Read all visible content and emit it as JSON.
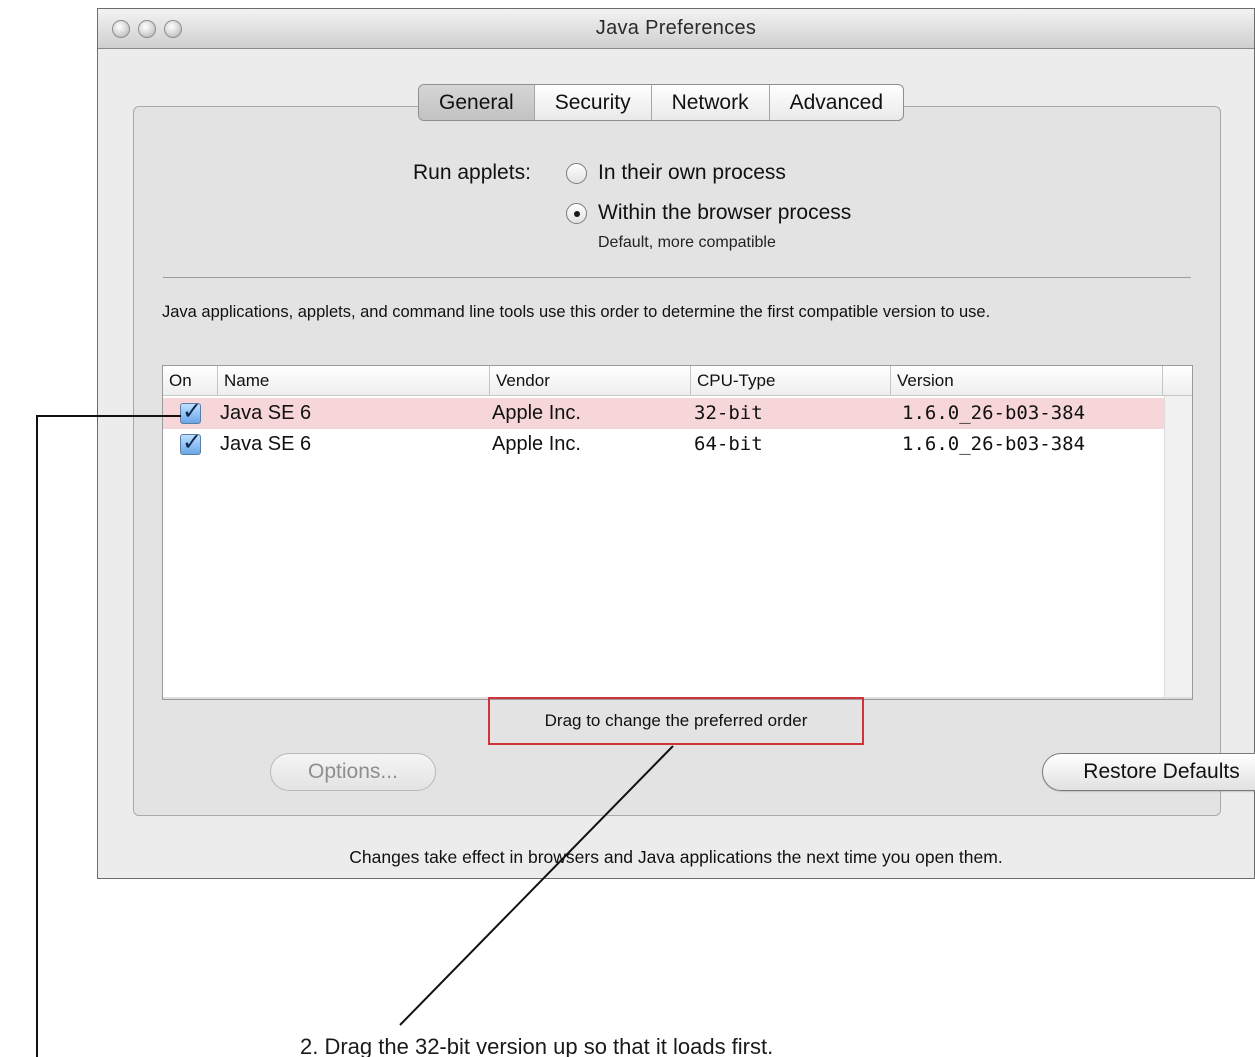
{
  "window": {
    "title": "Java Preferences"
  },
  "tabs": [
    {
      "label": "General",
      "selected": true
    },
    {
      "label": "Security",
      "selected": false
    },
    {
      "label": "Network",
      "selected": false
    },
    {
      "label": "Advanced",
      "selected": false
    }
  ],
  "run_applets": {
    "label": "Run applets:",
    "options": [
      {
        "label": "In their own process",
        "checked": false
      },
      {
        "label": "Within the browser process",
        "checked": true
      }
    ],
    "hint": "Default, more compatible"
  },
  "description": "Java applications, applets, and command line tools use this order to determine the first compatible version to use.",
  "table": {
    "headers": [
      "On",
      "Name",
      "Vendor",
      "CPU-Type",
      "Version"
    ],
    "rows": [
      {
        "on": true,
        "name": "Java SE 6",
        "vendor": "Apple Inc.",
        "cpu": "32-bit",
        "version": "1.6.0_26-b03-384",
        "selected": true
      },
      {
        "on": true,
        "name": "Java SE 6",
        "vendor": "Apple Inc.",
        "cpu": "64-bit",
        "version": "1.6.0_26-b03-384",
        "selected": false
      }
    ]
  },
  "drag_hint": "Drag to change the preferred order",
  "buttons": {
    "options": "Options...",
    "restore": "Restore Defaults"
  },
  "footer": "Changes take effect in browsers and Java applications the next time you open them.",
  "annotation": {
    "caption": "2.   Drag the 32-bit version up so that it loads first."
  },
  "colors": {
    "selected_row": "#f7d6d9",
    "highlight_box": "#d1333a"
  }
}
